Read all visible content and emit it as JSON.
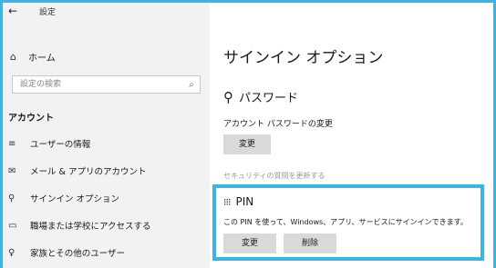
{
  "titlebar": {
    "back_icon": "←",
    "title": "設定"
  },
  "sidebar": {
    "home": {
      "icon": "⌂",
      "label": "ホーム"
    },
    "search": {
      "placeholder": "設定の検索",
      "icon": "⌕"
    },
    "section_title": "アカウント",
    "items": [
      {
        "icon": "≡",
        "label": "ユーザーの情報"
      },
      {
        "icon": "✉",
        "label": "メール & アプリのアカウント"
      },
      {
        "icon": "⚲",
        "label": "サインイン オプション"
      },
      {
        "icon": "▭",
        "label": "職場または学校にアクセスする"
      },
      {
        "icon": "♀",
        "label": "家族とその他のユーザー"
      }
    ]
  },
  "main": {
    "title": "サインイン オプション",
    "password": {
      "icon": "⚲",
      "heading": "パスワード",
      "description": "アカウント パスワードの変更",
      "change_label": "変更"
    },
    "security_link": "セキュリティの質問を更新する",
    "pin": {
      "icon": "⁝⁝⁝",
      "heading": "PIN",
      "description": "この PIN を使って、Windows、アプリ、サービスにサインインできます。",
      "change_label": "変更",
      "remove_label": "削除"
    }
  },
  "colors": {
    "highlight": "#3cb4e6",
    "sidebar_bg": "#f2f2f2",
    "button_bg": "#d9d9d9"
  }
}
